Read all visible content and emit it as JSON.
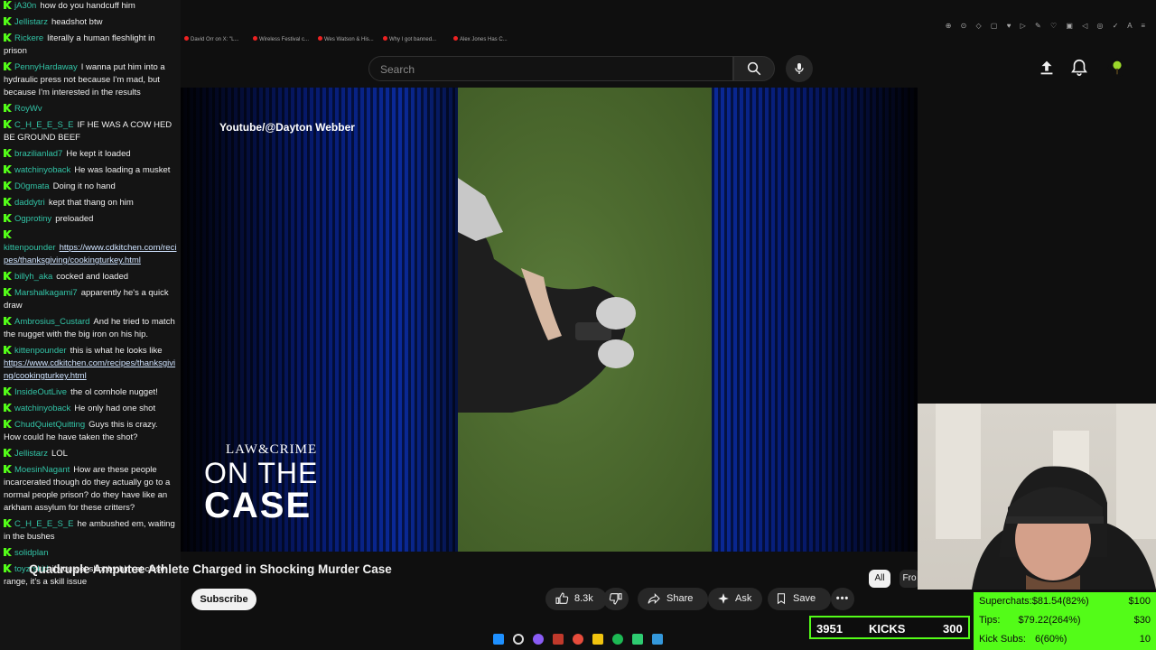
{
  "search": {
    "placeholder": "Search"
  },
  "bookmarks": [
    "David Orr on X: \"L...",
    "Wireless Festival c...",
    "Wes Watson & His...",
    "Why I got banned...",
    "Alex Jones Has C..."
  ],
  "video": {
    "watermark": "Youtube/@Dayton Webber",
    "logo_line1": "LAW&CRIME",
    "logo_line2": "ON THE",
    "logo_line3": "CASE",
    "title": "Quadruple Amputee Athlete Charged in Shocking Murder Case"
  },
  "actions": {
    "subscribe": "Subscribe",
    "likes": "8.3k",
    "share": "Share",
    "ask": "Ask",
    "save": "Save"
  },
  "chips": {
    "all": "All",
    "from": "Fro"
  },
  "overlay": {
    "kicks_count": "3951",
    "kicks_label": "KICKS",
    "kicks_goal": "300",
    "superchats_label": "Superchats:",
    "superchats_value": "$81.54(82%)",
    "superchats_goal": "$100",
    "tips_label": "Tips:",
    "tips_value": "$79.22(264%)",
    "tips_goal": "$30",
    "kicksubs_label": "Kick Subs:",
    "kicksubs_value": "6(60%)",
    "kicksubs_goal": "10"
  },
  "chat": [
    {
      "user": "jA30n",
      "text": "how do you handcuff him"
    },
    {
      "user": "Jellistarz",
      "text": "headshot btw"
    },
    {
      "user": "Rickere",
      "text": "literally a human fleshlight in prison"
    },
    {
      "user": "PennyHardaway",
      "text": "I wanna put him into a hydraulic press not because I'm mad, but because I'm interested in the results"
    },
    {
      "user": "RoyWv",
      "text": ""
    },
    {
      "user": "C_H_E_E_S_E",
      "text": "IF HE WAS A COW HED BE GROUND BEEF"
    },
    {
      "user": "brazilianlad7",
      "text": "He kept it loaded"
    },
    {
      "user": "watchinyoback",
      "text": "He was loading a musket"
    },
    {
      "user": "D0gmata",
      "text": "Doing it no hand"
    },
    {
      "user": "daddytri",
      "text": "kept that thang on him"
    },
    {
      "user": "Ogprotiny",
      "text": "preloaded"
    },
    {
      "user": "kittenpounder",
      "text": "",
      "link": "https://www.cdkitchen.com/recipes/thanksgiving/cookingturkey.html"
    },
    {
      "user": "billyh_aka",
      "text": "cocked and loaded"
    },
    {
      "user": "Marshalkagami7",
      "text": "apparently he's a quick draw"
    },
    {
      "user": "Ambrosius_Custard",
      "text": "And he tried to match the nugget with the big iron on his hip."
    },
    {
      "user": "kittenpounder",
      "text": "this is what he looks like",
      "link": "https://www.cdkitchen.com/recipes/thanksgiving/cookingturkey.html"
    },
    {
      "user": "InsideOutLive",
      "text": "the ol cornhole nugget!"
    },
    {
      "user": "watchinyoback",
      "text": "He only had one shot"
    },
    {
      "user": "ChudQuietQuitting",
      "text": "Guys this is crazy. How could he have taken the shot?"
    },
    {
      "user": "Jellistarz",
      "text": "LOL"
    },
    {
      "user": "MoesinNagant",
      "text": "How are these people incarcerated though do they actually go to a normal people prison? do they have like an arkham assylum for these critters?"
    },
    {
      "user": "C_H_E_E_S_E",
      "text": "he ambushed em, waiting in the bushes"
    },
    {
      "user": "solidplan",
      "text": ""
    },
    {
      "user": "toyzrskid",
      "text": "if you get shot by him at close range, it's a skill issue"
    }
  ],
  "colors": {
    "kick_green": "#53fc18",
    "username": "#32c3a6",
    "youtube_bg": "#0f0f0f"
  }
}
